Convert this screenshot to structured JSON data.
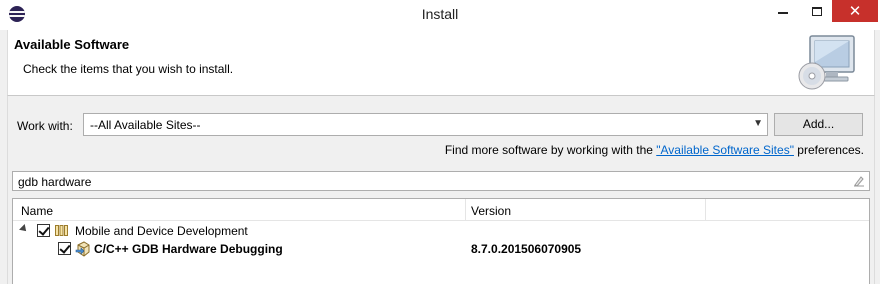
{
  "window": {
    "title": "Install",
    "minimize_icon": "minimize-icon",
    "maximize_icon": "maximize-icon",
    "close_glyph": "✕"
  },
  "header": {
    "title": "Available Software",
    "description": "Check the items that you wish to install."
  },
  "work_with": {
    "label": "Work with:",
    "value": "--All Available Sites--",
    "add_button": "Add..."
  },
  "find_more": {
    "prefix": "Find more software by working with the ",
    "link": "\"Available Software Sites\"",
    "suffix": " preferences."
  },
  "filter": {
    "value": "gdb hardware"
  },
  "tree": {
    "columns": [
      "Name",
      "Version"
    ],
    "rows": [
      {
        "name": "Mobile and Device Development",
        "version": "",
        "checked": true,
        "expanded": true
      },
      {
        "name": "C/C++ GDB Hardware Debugging",
        "version": "8.7.0.201506070905",
        "checked": true
      }
    ]
  },
  "colors": {
    "link": "#0066cc",
    "close_button": "#c7302b"
  }
}
